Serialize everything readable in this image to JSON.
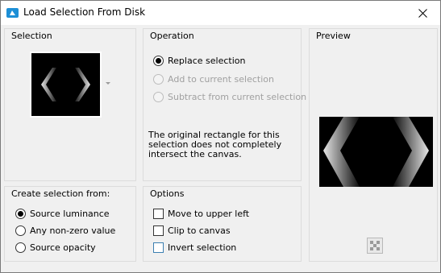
{
  "window": {
    "title": "Load Selection From Disk"
  },
  "selection": {
    "heading": "Selection"
  },
  "operation": {
    "heading": "Operation",
    "options": [
      {
        "label": "Replace selection",
        "selected": true,
        "enabled": true
      },
      {
        "label": "Add to current selection",
        "selected": false,
        "enabled": false
      },
      {
        "label": "Subtract from current selection",
        "selected": false,
        "enabled": false
      }
    ],
    "note": "The original rectangle for this selection does not completely intersect the canvas."
  },
  "preview": {
    "heading": "Preview"
  },
  "create_from": {
    "heading": "Create selection from:",
    "options": [
      {
        "label": "Source luminance",
        "selected": true
      },
      {
        "label": "Any non-zero value",
        "selected": false
      },
      {
        "label": "Source opacity",
        "selected": false
      }
    ]
  },
  "options": {
    "heading": "Options",
    "items": [
      {
        "label": "Move to upper left",
        "checked": false
      },
      {
        "label": "Clip to canvas",
        "checked": false
      },
      {
        "label": "Invert selection",
        "checked": false
      }
    ]
  },
  "colors": {
    "app_icon": "#1d8fd6",
    "panel_bg": "#f0f0f0",
    "thumbnail_bg": "#000000",
    "focus_border": "#3c7fb1"
  },
  "icons": {
    "app": "app-icon",
    "close": "close-icon",
    "dropdown": "chevron-down-icon",
    "checker": "transparency-checker-icon"
  }
}
